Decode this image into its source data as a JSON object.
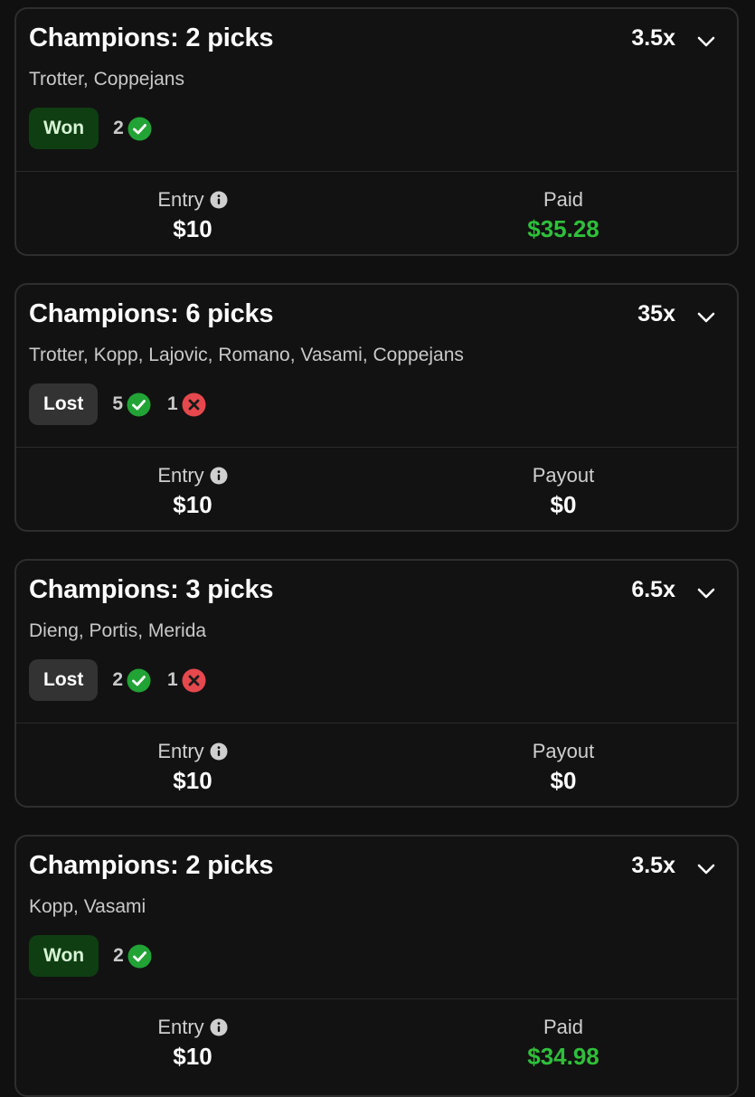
{
  "colors": {
    "background": "#101010",
    "card_border": "#2e2e2e",
    "won_badge_bg": "#0f3e12",
    "lost_badge_bg": "#333333",
    "check_green": "#22a336",
    "cross_red": "#e5484d",
    "paid_green": "#2fbf3b"
  },
  "icons": {
    "expand": "chevron-down-icon",
    "correct": "check-circle-icon",
    "incorrect": "x-circle-icon",
    "info": "info-icon"
  },
  "entries": [
    {
      "title": "Champions: 2 picks",
      "multiplier": "3.5x",
      "players": "Trotter, Coppejans",
      "status": "Won",
      "correct_count": "2",
      "incorrect_count": "",
      "entry_label": "Entry",
      "entry_value": "$10",
      "result_label": "Paid",
      "result_value": "$35.28"
    },
    {
      "title": "Champions: 6 picks",
      "multiplier": "35x",
      "players": "Trotter, Kopp, Lajovic, Romano, Vasami, Coppejans",
      "status": "Lost",
      "correct_count": "5",
      "incorrect_count": "1",
      "entry_label": "Entry",
      "entry_value": "$10",
      "result_label": "Payout",
      "result_value": "$0"
    },
    {
      "title": "Champions: 3 picks",
      "multiplier": "6.5x",
      "players": "Dieng, Portis, Merida",
      "status": "Lost",
      "correct_count": "2",
      "incorrect_count": "1",
      "entry_label": "Entry",
      "entry_value": "$10",
      "result_label": "Payout",
      "result_value": "$0"
    },
    {
      "title": "Champions: 2 picks",
      "multiplier": "3.5x",
      "players": "Kopp, Vasami",
      "status": "Won",
      "correct_count": "2",
      "incorrect_count": "",
      "entry_label": "Entry",
      "entry_value": "$10",
      "result_label": "Paid",
      "result_value": "$34.98"
    }
  ]
}
